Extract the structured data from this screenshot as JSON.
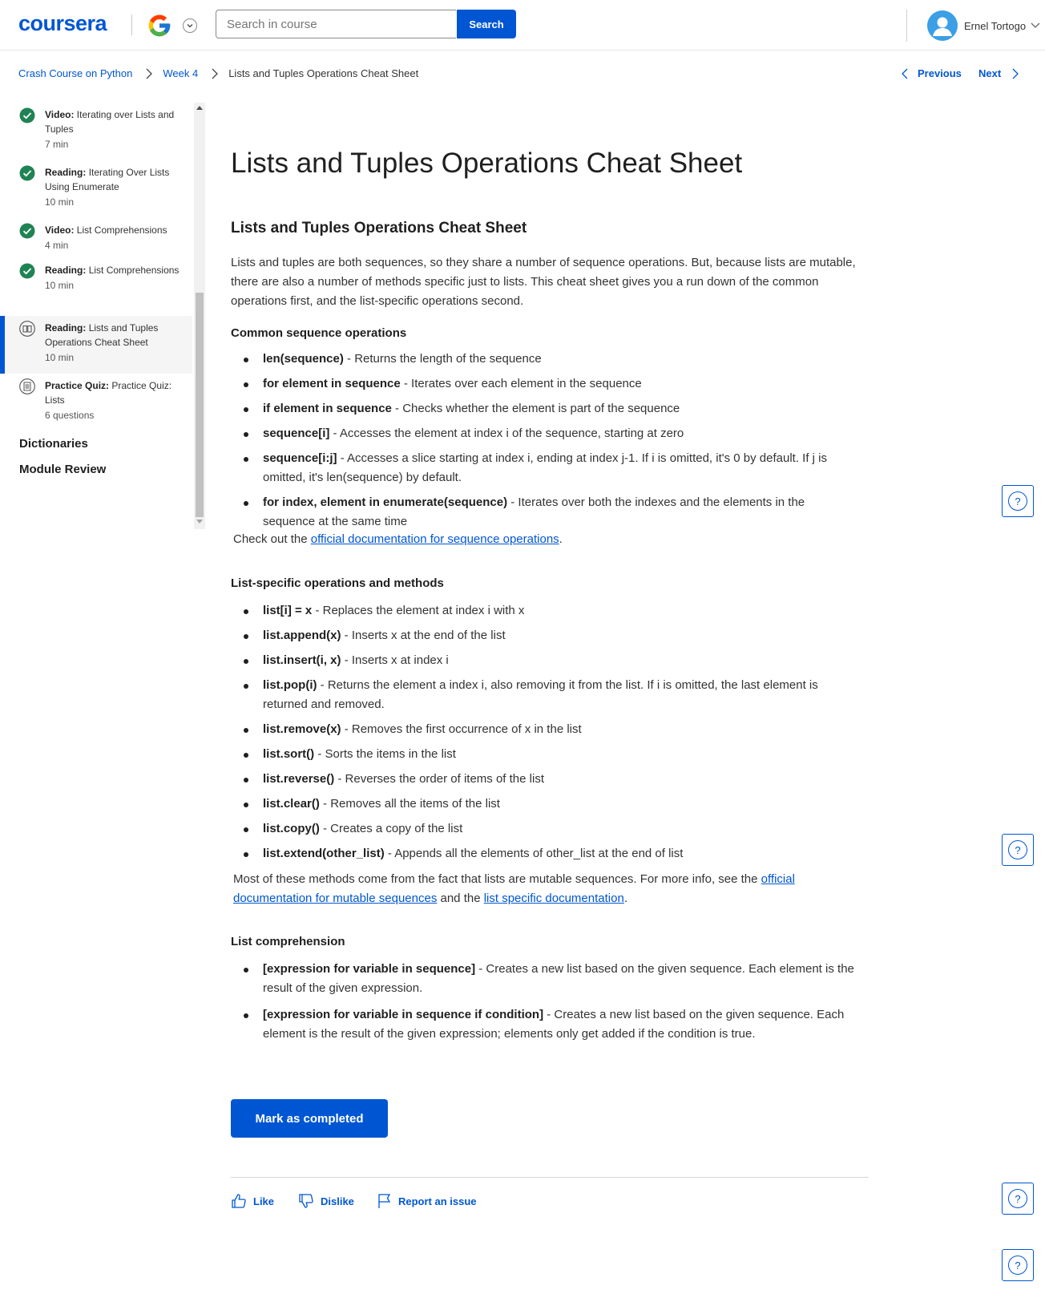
{
  "header": {
    "logo": "coursera",
    "search_placeholder": "Search in course",
    "search_button": "Search",
    "user_name": "Ernel Tortogo"
  },
  "breadcrumb": {
    "course": "Crash Course on Python",
    "week": "Week 4",
    "current": "Lists and Tuples Operations Cheat Sheet"
  },
  "nav": {
    "previous": "Previous",
    "next": "Next"
  },
  "sidebar": {
    "items": [
      {
        "type": "Video:",
        "title": "Iterating over Lists and Tuples",
        "meta": "7 min",
        "status": "completed",
        "active": false
      },
      {
        "type": "Reading:",
        "title": "Iterating Over Lists Using Enumerate",
        "meta": "10 min",
        "status": "completed",
        "active": false
      },
      {
        "type": "Video:",
        "title": "List Comprehensions",
        "meta": "4 min",
        "status": "completed",
        "active": false
      },
      {
        "type": "Reading:",
        "title": "List Comprehensions",
        "meta": "10 min",
        "status": "completed",
        "active": false
      },
      {
        "type": "Reading:",
        "title": "Lists and Tuples Operations Cheat Sheet",
        "meta": "10 min",
        "status": "reading",
        "active": true
      },
      {
        "type": "Practice Quiz:",
        "title": "Practice Quiz: Lists",
        "meta": "6 questions",
        "status": "quiz",
        "active": false
      }
    ],
    "sections": [
      "Dictionaries",
      "Module Review"
    ]
  },
  "main": {
    "title": "Lists and Tuples Operations Cheat Sheet",
    "subtitle": "Lists and Tuples Operations Cheat Sheet",
    "intro": "Lists and tuples are both sequences, so they share a number of sequence operations. But, because lists are mutable, there are also a number of methods specific just to lists. This cheat sheet gives you a run down of the common operations first, and the list-specific operations second.",
    "common_heading": "Common sequence operations",
    "common_ops": [
      {
        "code": "len(sequence)",
        "desc": " - Returns the length of the sequence"
      },
      {
        "code": "for element in sequence",
        "desc": " - Iterates over each element in the sequence"
      },
      {
        "code": "if element in sequence",
        "desc": " - Checks whether the element is part of the sequence"
      },
      {
        "code": "sequence[i]",
        "desc": " - Accesses the element at index i of the sequence, starting at zero"
      },
      {
        "code": "sequence[i:j]",
        "desc": " - Accesses a slice starting at index i, ending at index j-1. If i is omitted, it's 0 by default. If j is omitted, it's len(sequence) by default."
      },
      {
        "code": "for index, element in enumerate(sequence)",
        "desc": " - Iterates over both the indexes and the elements in the sequence at the same time"
      }
    ],
    "checkout_prefix": "Check out the ",
    "checkout_link": "official documentation for sequence operations",
    "checkout_suffix": ".",
    "list_heading": "List-specific operations and methods",
    "list_ops": [
      {
        "code": "list[i] = x",
        "desc": " - Replaces the element at index i with x"
      },
      {
        "code": "list.append(x)",
        "desc": " - Inserts x at the end of the list"
      },
      {
        "code": "list.insert(i, x)",
        "desc": " - Inserts x at index i"
      },
      {
        "code": "list.pop(i)",
        "desc": " - Returns the element a index i, also removing it from the list. If i is omitted, the last element is returned and removed."
      },
      {
        "code": "list.remove(x)",
        "desc": " - Removes the first occurrence of x in the list"
      },
      {
        "code": "list.sort()",
        "desc": " - Sorts the items in the list"
      },
      {
        "code": "list.reverse()",
        "desc": " - Reverses the order of items of the list"
      },
      {
        "code": "list.clear()",
        "desc": " - Removes all the items of the list"
      },
      {
        "code": "list.copy()",
        "desc": " - Creates a copy of the list"
      },
      {
        "code": "list.extend(other_list)",
        "desc": " - Appends all the elements of other_list at the end of list"
      }
    ],
    "more_prefix": "Most of these methods come from the fact that lists are mutable sequences. For more info, see the ",
    "more_link1": "official documentation for mutable sequences",
    "more_mid": " and the ",
    "more_link2": "list specific documentation",
    "more_suffix": ".",
    "comp_heading": "List comprehension",
    "comp_ops": [
      {
        "code": "[expression for variable in sequence]",
        "desc": " - Creates a new list based on the given sequence. Each element is the result of the given expression."
      },
      {
        "code": "[expression for variable in sequence if condition]",
        "desc": " - Creates a new list based on the given sequence. Each element is the result of the given expression; elements only get added if the condition is true."
      }
    ],
    "mark_button": "Mark as completed",
    "like": "Like",
    "dislike": "Dislike",
    "report": "Report an issue"
  },
  "help_label": "?",
  "colors": {
    "brand": "#0056d2",
    "completed": "#1f8354"
  }
}
